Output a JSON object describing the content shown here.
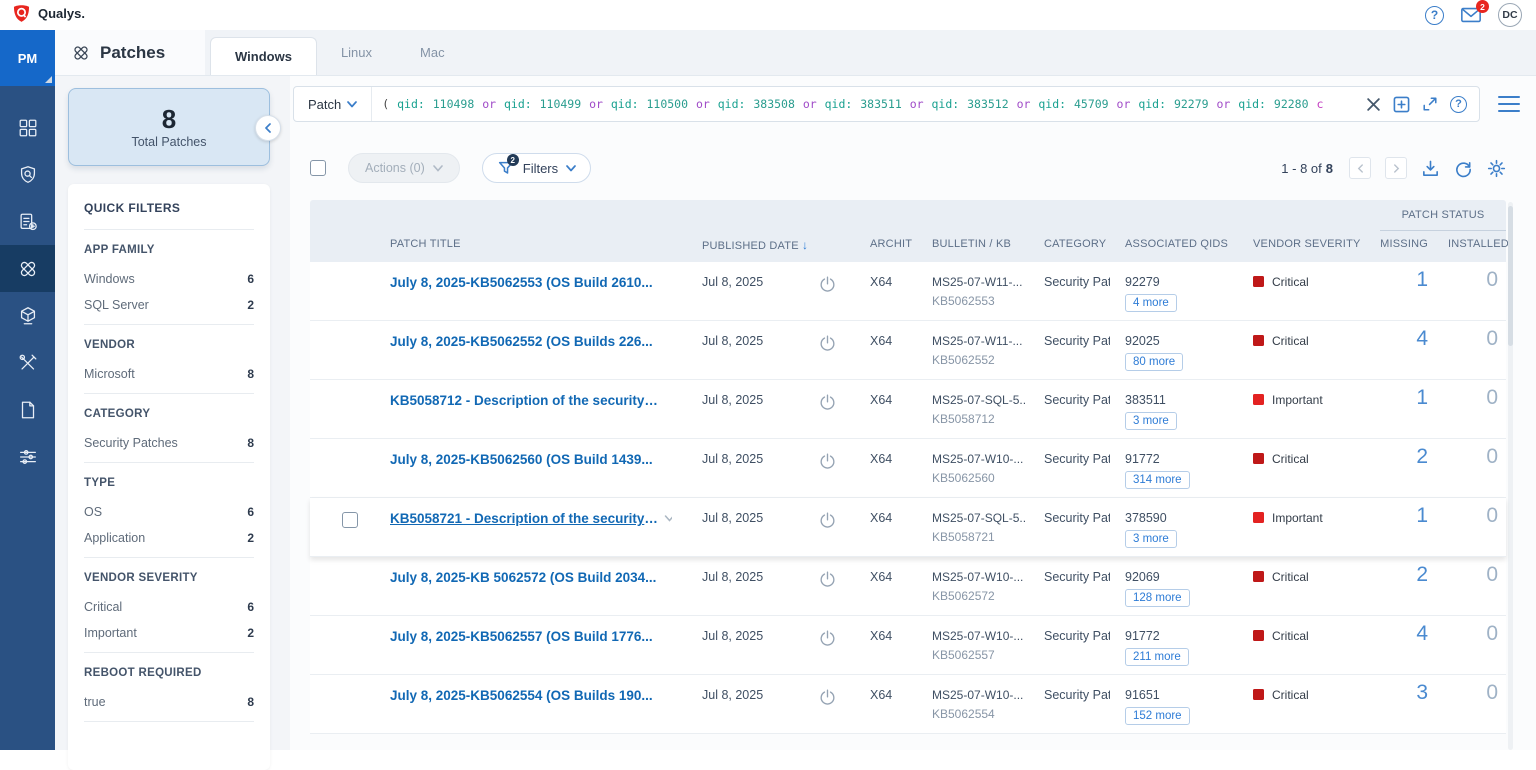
{
  "topbar": {
    "brand": "Qualys.",
    "notif_badge": "2",
    "avatar": "DC"
  },
  "sidebar": {
    "module": "PM",
    "items": [
      {
        "name": "dashboard",
        "active": false
      },
      {
        "name": "shield-scan",
        "active": false
      },
      {
        "name": "jobs",
        "active": false
      },
      {
        "name": "patches",
        "active": true
      },
      {
        "name": "assets",
        "active": false
      },
      {
        "name": "tools",
        "active": false
      },
      {
        "name": "reports",
        "active": false
      },
      {
        "name": "configuration",
        "active": false
      }
    ]
  },
  "header": {
    "title": "Patches",
    "tabs": [
      {
        "label": "Windows",
        "active": true
      },
      {
        "label": "Linux",
        "active": false
      },
      {
        "label": "Mac",
        "active": false
      }
    ]
  },
  "summary": {
    "count": "8",
    "label": "Total Patches"
  },
  "quick_filters": {
    "title": "QUICK FILTERS",
    "sections": [
      {
        "title": "APP FAMILY",
        "items": [
          {
            "label": "Windows",
            "count": "6"
          },
          {
            "label": "SQL Server",
            "count": "2"
          }
        ]
      },
      {
        "title": "VENDOR",
        "items": [
          {
            "label": "Microsoft",
            "count": "8"
          }
        ]
      },
      {
        "title": "CATEGORY",
        "items": [
          {
            "label": "Security Patches",
            "count": "8"
          }
        ]
      },
      {
        "title": "TYPE",
        "items": [
          {
            "label": "OS",
            "count": "6"
          },
          {
            "label": "Application",
            "count": "2"
          }
        ]
      },
      {
        "title": "VENDOR SEVERITY",
        "items": [
          {
            "label": "Critical",
            "count": "6"
          },
          {
            "label": "Important",
            "count": "2"
          }
        ]
      },
      {
        "title": "REBOOT REQUIRED",
        "items": [
          {
            "label": "true",
            "count": "8"
          }
        ]
      }
    ]
  },
  "search": {
    "scope": "Patch",
    "query": "( qid: 110498 or qid: 110499 or qid: 110500 or qid: 383508 or qid: 383511 or qid: 383512 or qid: 45709 or qid: 92279 or qid: 92280 c"
  },
  "toolbar": {
    "actions_label": "Actions (0)",
    "filters_label": "Filters",
    "filters_badge": "2",
    "pagination_prefix": "1 - 8 of",
    "pagination_total": "8"
  },
  "table": {
    "group_header": "PATCH STATUS",
    "columns": [
      "PATCH TITLE",
      "PUBLISHED DATE",
      "ARCHIT",
      "BULLETIN / KB",
      "CATEGORY",
      "ASSOCIATED QIDS",
      "VENDOR SEVERITY",
      "MISSING",
      "INSTALLED"
    ],
    "rows": [
      {
        "title": "July 8, 2025-KB5062553 (OS Build 2610...",
        "date": "Jul 8, 2025",
        "arch": "X64",
        "bulletin": "MS25-07-W11-...",
        "kb": "KB5062553",
        "category": "Security Pat...",
        "qid": "92279",
        "more": "4 more",
        "severity": "Critical",
        "sev_level": "critical",
        "missing": "1",
        "installed": "0",
        "hovered": false
      },
      {
        "title": "July 8, 2025-KB5062552 (OS Builds 226...",
        "date": "Jul 8, 2025",
        "arch": "X64",
        "bulletin": "MS25-07-W11-...",
        "kb": "KB5062552",
        "category": "Security Pat...",
        "qid": "92025",
        "more": "80 more",
        "severity": "Critical",
        "sev_level": "critical",
        "missing": "4",
        "installed": "0",
        "hovered": false
      },
      {
        "title": "KB5058712 - Description of the security ...",
        "date": "Jul 8, 2025",
        "arch": "X64",
        "bulletin": "MS25-07-SQL-5...",
        "kb": "KB5058712",
        "category": "Security Pat...",
        "qid": "383511",
        "more": "3 more",
        "severity": "Important",
        "sev_level": "important",
        "missing": "1",
        "installed": "0",
        "hovered": false
      },
      {
        "title": "July 8, 2025-KB5062560 (OS Build 1439...",
        "date": "Jul 8, 2025",
        "arch": "X64",
        "bulletin": "MS25-07-W10-...",
        "kb": "KB5062560",
        "category": "Security Pat...",
        "qid": "91772",
        "more": "314 more",
        "severity": "Critical",
        "sev_level": "critical",
        "missing": "2",
        "installed": "0",
        "hovered": false
      },
      {
        "title": "KB5058721 - Description of the security ...",
        "date": "Jul 8, 2025",
        "arch": "X64",
        "bulletin": "MS25-07-SQL-5...",
        "kb": "KB5058721",
        "category": "Security Pat...",
        "qid": "378590",
        "more": "3 more",
        "severity": "Important",
        "sev_level": "important",
        "missing": "1",
        "installed": "0",
        "hovered": true
      },
      {
        "title": "July 8, 2025-KB 5062572 (OS Build 2034...",
        "date": "Jul 8, 2025",
        "arch": "X64",
        "bulletin": "MS25-07-W10-...",
        "kb": "KB5062572",
        "category": "Security Pat...",
        "qid": "92069",
        "more": "128 more",
        "severity": "Critical",
        "sev_level": "critical",
        "missing": "2",
        "installed": "0",
        "hovered": false
      },
      {
        "title": "July 8, 2025-KB5062557 (OS Build 1776...",
        "date": "Jul 8, 2025",
        "arch": "X64",
        "bulletin": "MS25-07-W10-...",
        "kb": "KB5062557",
        "category": "Security Pat...",
        "qid": "91772",
        "more": "211 more",
        "severity": "Critical",
        "sev_level": "critical",
        "missing": "4",
        "installed": "0",
        "hovered": false
      },
      {
        "title": "July 8, 2025-KB5062554 (OS Builds 190...",
        "date": "Jul 8, 2025",
        "arch": "X64",
        "bulletin": "MS25-07-W10-...",
        "kb": "KB5062554",
        "category": "Security Pat...",
        "qid": "91651",
        "more": "152 more",
        "severity": "Critical",
        "sev_level": "critical",
        "missing": "3",
        "installed": "0",
        "hovered": false
      }
    ]
  },
  "colors": {
    "brand_red": "#e8261f",
    "accent_blue": "#2e7cd6",
    "critical": "#bf1818",
    "important": "#e32221",
    "missing_blue": "#4a8ad0",
    "query_field": "#19a190",
    "query_value": "#2a9d8f",
    "query_operator": "#a04bc8",
    "query_paren": "#444444",
    "query_fragment": "#c23bc0"
  }
}
